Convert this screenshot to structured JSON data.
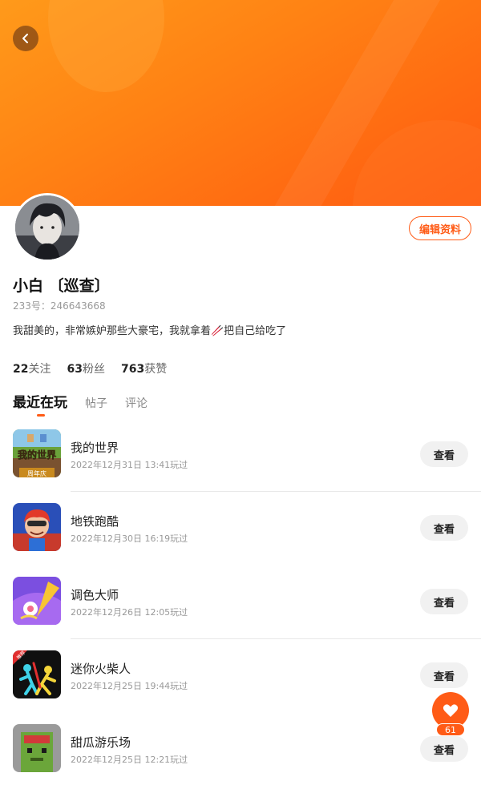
{
  "profile": {
    "name": "小白 〔巡查〕",
    "id_text": "233号：246643668",
    "bio": "我甜美的，非常嫉妒那些大豪宅，我就拿着🥢把自己给吃了",
    "edit_label": "编辑资料",
    "stats": [
      {
        "count": "22",
        "label": "关注"
      },
      {
        "count": "63",
        "label": "粉丝"
      },
      {
        "count": "763",
        "label": "获赞"
      }
    ]
  },
  "tabs": [
    {
      "label": "最近在玩",
      "active": true
    },
    {
      "label": "帖子",
      "active": false
    },
    {
      "label": "评论",
      "active": false
    }
  ],
  "games": [
    {
      "name": "我的世界",
      "time": "2022年12月31日 13:41玩过",
      "action": "查看",
      "icon": "minecraft-icon"
    },
    {
      "name": "地铁跑酷",
      "time": "2022年12月30日 16:19玩过",
      "action": "查看",
      "icon": "subway-surfers-icon"
    },
    {
      "name": "调色大师",
      "time": "2022年12月26日 12:05玩过",
      "action": "查看",
      "icon": "color-master-icon"
    },
    {
      "name": "迷你火柴人",
      "time": "2022年12月25日 19:44玩过",
      "action": "查看",
      "icon": "stickman-icon"
    },
    {
      "name": "甜瓜游乐场",
      "time": "2022年12月25日 12:21玩过",
      "action": "查看",
      "icon": "melon-playground-icon"
    }
  ],
  "game_icon_text": {
    "minecraft_title": "我的世界",
    "minecraft_sub": "周年庆",
    "stickman_badge": "推荐"
  },
  "like": {
    "count": "61"
  },
  "colors": {
    "accent": "#ff5b16",
    "banner": "#ff7a14"
  }
}
